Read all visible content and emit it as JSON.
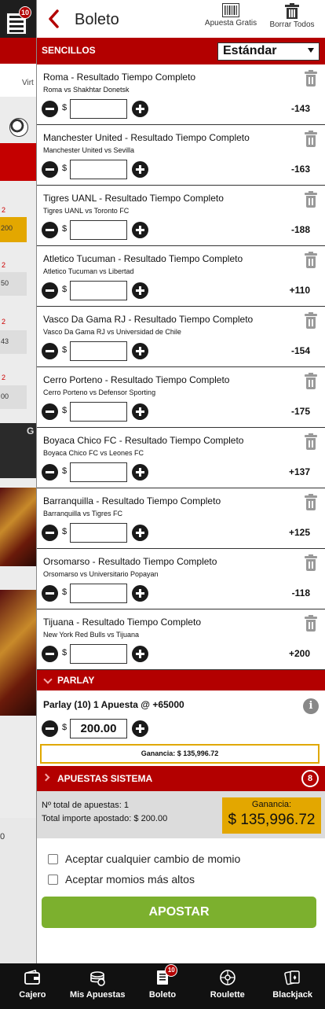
{
  "background": {
    "badge_count": "10",
    "virt_label": "Virt",
    "odds_partial": [
      "200",
      "50",
      "43",
      "00"
    ],
    "red_marks": [
      "2",
      "2",
      "2",
      "2"
    ],
    "letter_g": "G",
    "zero": "0"
  },
  "slip": {
    "title": "Boleto",
    "free_bet_label": "Apuesta Gratis",
    "clear_all_label": "Borrar Todos",
    "singles_label": "SENCILLOS",
    "mode_select": "Estándar",
    "currency": "$",
    "bets": [
      {
        "market": "Roma - Resultado Tiempo Completo",
        "match": "Roma vs Shakhtar Donetsk",
        "odds": "-143"
      },
      {
        "market": "Manchester United - Resultado Tiempo Completo",
        "match": "Manchester United vs Sevilla",
        "odds": "-163"
      },
      {
        "market": "Tigres UANL - Resultado Tiempo Completo",
        "match": "Tigres UANL vs Toronto FC",
        "odds": "-188"
      },
      {
        "market": "Atletico Tucuman - Resultado Tiempo Completo",
        "match": "Atletico Tucuman vs Libertad",
        "odds": "+110"
      },
      {
        "market": "Vasco Da Gama RJ - Resultado Tiempo Completo",
        "match": "Vasco Da Gama RJ vs Universidad de Chile",
        "odds": "-154"
      },
      {
        "market": "Cerro Porteno - Resultado Tiempo Completo",
        "match": "Cerro Porteno vs Defensor Sporting",
        "odds": "-175"
      },
      {
        "market": "Boyaca Chico FC - Resultado Tiempo Completo",
        "match": "Boyaca Chico FC vs Leones FC",
        "odds": "+137"
      },
      {
        "market": "Barranquilla - Resultado Tiempo Completo",
        "match": "Barranquilla vs Tigres FC",
        "odds": "+125"
      },
      {
        "market": "Orsomarso - Resultado Tiempo Completo",
        "match": "Orsomarso vs Universitario Popayan",
        "odds": "-118"
      },
      {
        "market": "Tijuana - Resultado Tiempo Completo",
        "match": "New York Red Bulls vs Tijuana",
        "odds": "+200"
      }
    ],
    "parlay": {
      "header": "PARLAY",
      "line": "Parlay (10)   1 Apuesta @ +65000",
      "stake": "200.00",
      "ganancia": "Ganancia: $ 135,996.72"
    },
    "system": {
      "header": "APUESTAS SISTEMA",
      "count": "8"
    },
    "summary": {
      "total_bets": "Nº total de apuestas: 1",
      "total_amount": "Total importe apostado: $ 200.00",
      "gain_label": "Ganancia:",
      "gain_value": "$ 135,996.72"
    },
    "options": {
      "accept_any": "Aceptar cualquier cambio de momio",
      "accept_higher": "Aceptar momios más altos"
    },
    "submit_label": "APOSTAR"
  },
  "nav": {
    "items": [
      {
        "label": "Cajero",
        "icon": "wallet-icon"
      },
      {
        "label": "Mis Apuestas",
        "icon": "coins-icon"
      },
      {
        "label": "Boleto",
        "icon": "betslip-icon",
        "badge": "10"
      },
      {
        "label": "Roulette",
        "icon": "roulette-icon"
      },
      {
        "label": "Blackjack",
        "icon": "cards-icon"
      }
    ]
  },
  "colors": {
    "brand_red": "#b30000",
    "gain_gold": "#e3a700",
    "submit_green": "#7cb02e"
  }
}
